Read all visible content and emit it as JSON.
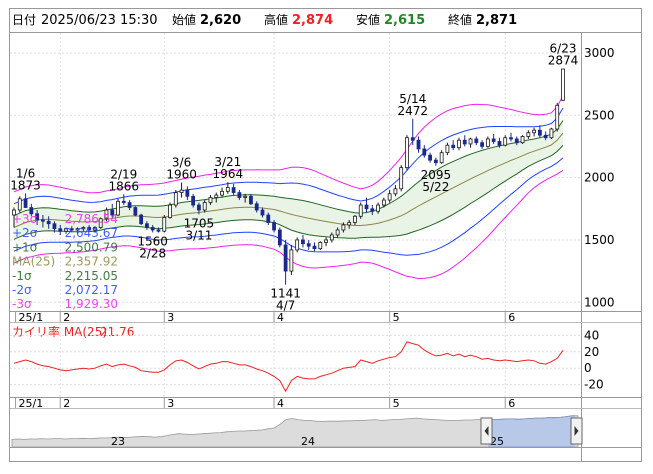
{
  "header": {
    "date_label": "日付",
    "datetime": "2025/06/23 15:30",
    "open_label": "始値",
    "open_value": "2,620",
    "high_label": "高値",
    "high_value": "2,874",
    "low_label": "安値",
    "low_value": "2,615",
    "close_label": "終値",
    "close_value": "2,871"
  },
  "colors": {
    "up": "#1a1a1a",
    "down": "#1a2a8a",
    "sigma3": "#ee22ee",
    "sigma2": "#2244ff",
    "sigma1": "#226622",
    "ma": "#888844",
    "deviation": "#ee2222",
    "high_value": "#ee2222",
    "low_value": "#228822",
    "volume_area": "#b8c8e8"
  },
  "chart_data": [
    {
      "type": "candlestick",
      "y_ticks": [
        "3000",
        "2500",
        "2000",
        "1500",
        "1000"
      ],
      "ylim": [
        930,
        3160
      ],
      "x_ticks": [
        "25/1",
        "2",
        "3",
        "4",
        "5",
        "6"
      ],
      "candles": [
        {
          "o": 1700,
          "h": 1760,
          "l": 1600,
          "c": 1740
        },
        {
          "o": 1740,
          "h": 1850,
          "l": 1720,
          "c": 1830
        },
        {
          "o": 1830,
          "h": 1873,
          "l": 1790,
          "c": 1760
        },
        {
          "o": 1760,
          "h": 1790,
          "l": 1690,
          "c": 1710
        },
        {
          "o": 1710,
          "h": 1740,
          "l": 1620,
          "c": 1660
        },
        {
          "o": 1660,
          "h": 1700,
          "l": 1600,
          "c": 1650
        },
        {
          "o": 1650,
          "h": 1690,
          "l": 1590,
          "c": 1630
        },
        {
          "o": 1630,
          "h": 1650,
          "l": 1560,
          "c": 1590
        },
        {
          "o": 1590,
          "h": 1620,
          "l": 1540,
          "c": 1570
        },
        {
          "o": 1570,
          "h": 1600,
          "l": 1550,
          "c": 1590
        },
        {
          "o": 1590,
          "h": 1610,
          "l": 1560,
          "c": 1580
        },
        {
          "o": 1580,
          "h": 1600,
          "l": 1550,
          "c": 1590
        },
        {
          "o": 1590,
          "h": 1610,
          "l": 1570,
          "c": 1600
        },
        {
          "o": 1600,
          "h": 1620,
          "l": 1570,
          "c": 1580
        },
        {
          "o": 1580,
          "h": 1610,
          "l": 1560,
          "c": 1600
        },
        {
          "o": 1600,
          "h": 1680,
          "l": 1590,
          "c": 1670
        },
        {
          "o": 1670,
          "h": 1760,
          "l": 1650,
          "c": 1740
        },
        {
          "o": 1740,
          "h": 1790,
          "l": 1680,
          "c": 1700
        },
        {
          "o": 1700,
          "h": 1830,
          "l": 1690,
          "c": 1810
        },
        {
          "o": 1810,
          "h": 1866,
          "l": 1780,
          "c": 1800
        },
        {
          "o": 1800,
          "h": 1820,
          "l": 1740,
          "c": 1760
        },
        {
          "o": 1760,
          "h": 1770,
          "l": 1690,
          "c": 1700
        },
        {
          "o": 1700,
          "h": 1710,
          "l": 1620,
          "c": 1630
        },
        {
          "o": 1630,
          "h": 1650,
          "l": 1580,
          "c": 1600
        },
        {
          "o": 1600,
          "h": 1620,
          "l": 1560,
          "c": 1580
        },
        {
          "o": 1580,
          "h": 1600,
          "l": 1560,
          "c": 1570
        },
        {
          "o": 1570,
          "h": 1700,
          "l": 1560,
          "c": 1680
        },
        {
          "o": 1680,
          "h": 1800,
          "l": 1670,
          "c": 1780
        },
        {
          "o": 1780,
          "h": 1900,
          "l": 1760,
          "c": 1880
        },
        {
          "o": 1880,
          "h": 1960,
          "l": 1840,
          "c": 1900
        },
        {
          "o": 1900,
          "h": 1930,
          "l": 1820,
          "c": 1850
        },
        {
          "o": 1850,
          "h": 1870,
          "l": 1760,
          "c": 1780
        },
        {
          "o": 1780,
          "h": 1800,
          "l": 1705,
          "c": 1740
        },
        {
          "o": 1740,
          "h": 1820,
          "l": 1720,
          "c": 1800
        },
        {
          "o": 1800,
          "h": 1860,
          "l": 1780,
          "c": 1840
        },
        {
          "o": 1840,
          "h": 1880,
          "l": 1800,
          "c": 1860
        },
        {
          "o": 1860,
          "h": 1920,
          "l": 1840,
          "c": 1890
        },
        {
          "o": 1890,
          "h": 1964,
          "l": 1870,
          "c": 1920
        },
        {
          "o": 1920,
          "h": 1950,
          "l": 1860,
          "c": 1880
        },
        {
          "o": 1880,
          "h": 1900,
          "l": 1820,
          "c": 1840
        },
        {
          "o": 1840,
          "h": 1870,
          "l": 1800,
          "c": 1850
        },
        {
          "o": 1850,
          "h": 1870,
          "l": 1780,
          "c": 1790
        },
        {
          "o": 1790,
          "h": 1810,
          "l": 1720,
          "c": 1740
        },
        {
          "o": 1740,
          "h": 1760,
          "l": 1680,
          "c": 1700
        },
        {
          "o": 1700,
          "h": 1720,
          "l": 1620,
          "c": 1640
        },
        {
          "o": 1640,
          "h": 1660,
          "l": 1560,
          "c": 1580
        },
        {
          "o": 1580,
          "h": 1600,
          "l": 1440,
          "c": 1460
        },
        {
          "o": 1460,
          "h": 1500,
          "l": 1141,
          "c": 1250
        },
        {
          "o": 1250,
          "h": 1460,
          "l": 1220,
          "c": 1420
        },
        {
          "o": 1420,
          "h": 1520,
          "l": 1400,
          "c": 1500
        },
        {
          "o": 1500,
          "h": 1540,
          "l": 1440,
          "c": 1470
        },
        {
          "o": 1470,
          "h": 1500,
          "l": 1420,
          "c": 1450
        },
        {
          "o": 1450,
          "h": 1480,
          "l": 1410,
          "c": 1430
        },
        {
          "o": 1430,
          "h": 1490,
          "l": 1420,
          "c": 1480
        },
        {
          "o": 1480,
          "h": 1520,
          "l": 1450,
          "c": 1500
        },
        {
          "o": 1500,
          "h": 1560,
          "l": 1480,
          "c": 1540
        },
        {
          "o": 1540,
          "h": 1600,
          "l": 1520,
          "c": 1580
        },
        {
          "o": 1580,
          "h": 1640,
          "l": 1560,
          "c": 1620
        },
        {
          "o": 1620,
          "h": 1660,
          "l": 1590,
          "c": 1640
        },
        {
          "o": 1640,
          "h": 1700,
          "l": 1620,
          "c": 1690
        },
        {
          "o": 1690,
          "h": 1800,
          "l": 1670,
          "c": 1780
        },
        {
          "o": 1780,
          "h": 1840,
          "l": 1720,
          "c": 1750
        },
        {
          "o": 1750,
          "h": 1780,
          "l": 1700,
          "c": 1730
        },
        {
          "o": 1730,
          "h": 1800,
          "l": 1710,
          "c": 1780
        },
        {
          "o": 1780,
          "h": 1840,
          "l": 1760,
          "c": 1820
        },
        {
          "o": 1820,
          "h": 1900,
          "l": 1800,
          "c": 1870
        },
        {
          "o": 1870,
          "h": 1940,
          "l": 1850,
          "c": 1910
        },
        {
          "o": 1910,
          "h": 2100,
          "l": 1890,
          "c": 2080
        },
        {
          "o": 2080,
          "h": 2340,
          "l": 2060,
          "c": 2320
        },
        {
          "o": 2320,
          "h": 2472,
          "l": 2260,
          "c": 2300
        },
        {
          "o": 2300,
          "h": 2330,
          "l": 2200,
          "c": 2230
        },
        {
          "o": 2230,
          "h": 2260,
          "l": 2160,
          "c": 2180
        },
        {
          "o": 2180,
          "h": 2200,
          "l": 2120,
          "c": 2140
        },
        {
          "o": 2140,
          "h": 2160,
          "l": 2095,
          "c": 2120
        },
        {
          "o": 2120,
          "h": 2220,
          "l": 2110,
          "c": 2200
        },
        {
          "o": 2200,
          "h": 2280,
          "l": 2180,
          "c": 2260
        },
        {
          "o": 2260,
          "h": 2300,
          "l": 2220,
          "c": 2240
        },
        {
          "o": 2240,
          "h": 2320,
          "l": 2220,
          "c": 2300
        },
        {
          "o": 2300,
          "h": 2340,
          "l": 2250,
          "c": 2270
        },
        {
          "o": 2270,
          "h": 2320,
          "l": 2240,
          "c": 2310
        },
        {
          "o": 2310,
          "h": 2330,
          "l": 2260,
          "c": 2280
        },
        {
          "o": 2280,
          "h": 2300,
          "l": 2230,
          "c": 2250
        },
        {
          "o": 2250,
          "h": 2330,
          "l": 2240,
          "c": 2310
        },
        {
          "o": 2310,
          "h": 2350,
          "l": 2270,
          "c": 2290
        },
        {
          "o": 2290,
          "h": 2320,
          "l": 2240,
          "c": 2260
        },
        {
          "o": 2260,
          "h": 2340,
          "l": 2250,
          "c": 2320
        },
        {
          "o": 2320,
          "h": 2360,
          "l": 2290,
          "c": 2310
        },
        {
          "o": 2310,
          "h": 2330,
          "l": 2260,
          "c": 2280
        },
        {
          "o": 2280,
          "h": 2340,
          "l": 2270,
          "c": 2330
        },
        {
          "o": 2330,
          "h": 2380,
          "l": 2310,
          "c": 2360
        },
        {
          "o": 2360,
          "h": 2400,
          "l": 2330,
          "c": 2380
        },
        {
          "o": 2380,
          "h": 2420,
          "l": 2320,
          "c": 2340
        },
        {
          "o": 2340,
          "h": 2370,
          "l": 2300,
          "c": 2320
        },
        {
          "o": 2320,
          "h": 2400,
          "l": 2310,
          "c": 2390
        },
        {
          "o": 2390,
          "h": 2600,
          "l": 2370,
          "c": 2580
        },
        {
          "o": 2620,
          "h": 2874,
          "l": 2615,
          "c": 2871
        }
      ],
      "ma25": [
        1600,
        1620,
        1640,
        1650,
        1660,
        1665,
        1665,
        1662,
        1658,
        1655,
        1650,
        1648,
        1645,
        1645,
        1648,
        1655,
        1665,
        1672,
        1680,
        1688,
        1692,
        1692,
        1690,
        1686,
        1682,
        1680,
        1684,
        1690,
        1698,
        1706,
        1712,
        1716,
        1720,
        1726,
        1732,
        1738,
        1745,
        1752,
        1757,
        1760,
        1762,
        1762,
        1760,
        1756,
        1750,
        1744,
        1732,
        1718,
        1705,
        1694,
        1684,
        1674,
        1665,
        1656,
        1648,
        1640,
        1632,
        1626,
        1620,
        1616,
        1616,
        1620,
        1626,
        1634,
        1646,
        1660,
        1676,
        1694,
        1718,
        1746,
        1772,
        1798,
        1822,
        1846,
        1870,
        1894,
        1918,
        1942,
        1966,
        1990,
        2012,
        2034,
        2056,
        2078,
        2098,
        2118,
        2138,
        2156,
        2176,
        2196,
        2212,
        2228,
        2244,
        2262,
        2300,
        2358
      ],
      "sigma1": [
        95,
        95,
        95,
        95,
        94,
        93,
        92,
        90,
        88,
        86,
        84,
        82,
        80,
        78,
        77,
        76,
        76,
        76,
        77,
        78,
        80,
        82,
        84,
        86,
        88,
        90,
        91,
        92,
        93,
        94,
        95,
        96,
        97,
        98,
        98,
        99,
        99,
        100,
        100,
        100,
        100,
        100,
        101,
        102,
        104,
        106,
        110,
        118,
        126,
        130,
        132,
        132,
        130,
        126,
        122,
        118,
        114,
        110,
        106,
        102,
        98,
        100,
        104,
        112,
        122,
        132,
        144,
        156,
        170,
        182,
        194,
        202,
        208,
        212,
        214,
        214,
        212,
        208,
        204,
        198,
        192,
        184,
        176,
        166,
        156,
        146,
        136,
        126,
        116,
        106,
        98,
        92,
        88,
        86,
        90,
        100
      ],
      "sigma_labels": [
        {
          "label": "+3σ",
          "value": "2,786.54",
          "color": "#ee22ee"
        },
        {
          "label": "+2σ",
          "value": "2,643.67",
          "color": "#2244ff"
        },
        {
          "label": "+1σ",
          "value": "2,500.79",
          "color": "#226622"
        },
        {
          "label": "MA(25)",
          "value": "2,357.92",
          "color": "#888844"
        },
        {
          "label": "-1σ",
          "value": "2,215.05",
          "color": "#226622"
        },
        {
          "label": "-2σ",
          "value": "2,072.17",
          "color": "#2244ff"
        },
        {
          "label": "-3σ",
          "value": "1,929.30",
          "color": "#ee22ee"
        }
      ],
      "annotations": [
        {
          "i": 2,
          "date": "1/6",
          "price": "1873",
          "pos": "above"
        },
        {
          "i": 19,
          "date": "2/19",
          "price": "1866",
          "pos": "above"
        },
        {
          "i": 24,
          "date": "2/28",
          "price": "1560",
          "pos": "below"
        },
        {
          "i": 29,
          "date": "3/6",
          "price": "1960",
          "pos": "above"
        },
        {
          "i": 32,
          "date": "3/11",
          "price": "1705",
          "pos": "below"
        },
        {
          "i": 37,
          "date": "3/21",
          "price": "1964",
          "pos": "above"
        },
        {
          "i": 47,
          "date": "4/7",
          "price": "1141",
          "pos": "below"
        },
        {
          "i": 69,
          "date": "5/14",
          "price": "2472",
          "pos": "above"
        },
        {
          "i": 73,
          "date": "5/22",
          "price": "2095",
          "pos": "below"
        },
        {
          "i": 95,
          "date": "6/23",
          "price": "2874",
          "pos": "above"
        }
      ]
    },
    {
      "type": "line",
      "title": "カイリ率 MA(25)",
      "current_value": "21.76",
      "y_ticks": [
        "40",
        "20",
        "0",
        "-20"
      ],
      "ylim": [
        -35,
        55
      ],
      "values": [
        6,
        8,
        10,
        8,
        5,
        3,
        2,
        0,
        -2,
        -3,
        -2,
        -1,
        0,
        -1,
        0,
        3,
        5,
        2,
        4,
        5,
        3,
        1,
        -3,
        -4,
        -5,
        -5,
        -2,
        4,
        9,
        10,
        7,
        3,
        -1,
        2,
        5,
        6,
        8,
        8,
        6,
        4,
        4,
        2,
        -1,
        -3,
        -6,
        -10,
        -15,
        -28,
        -15,
        -10,
        -12,
        -13,
        -13,
        -10,
        -8,
        -6,
        -3,
        0,
        1,
        2,
        10,
        8,
        6,
        9,
        11,
        13,
        14,
        20,
        32,
        30,
        28,
        22,
        18,
        15,
        16,
        18,
        15,
        17,
        14,
        16,
        14,
        11,
        12,
        10,
        9,
        10,
        9,
        8,
        9,
        10,
        9,
        6,
        5,
        8,
        12,
        21.76
      ]
    },
    {
      "type": "area",
      "x_ticks": [
        "25/1",
        "2",
        "3",
        "4",
        "5",
        "6"
      ],
      "period_labels": [
        "23",
        "24",
        "25"
      ],
      "values": [
        20,
        21,
        20,
        21,
        21,
        22,
        21,
        22,
        22,
        21,
        22,
        22,
        23,
        22,
        23,
        24,
        24,
        25,
        26,
        25,
        26,
        27,
        28,
        27,
        26,
        27,
        30,
        33,
        35,
        34,
        33,
        34,
        35,
        36,
        37,
        38,
        40,
        41,
        42,
        42,
        43,
        44,
        45,
        48,
        50,
        60,
        72,
        75,
        72,
        70,
        70,
        68,
        67,
        68,
        68,
        68,
        69,
        69,
        70,
        70,
        71,
        72,
        70,
        71,
        72,
        72,
        74,
        75,
        76,
        74,
        73,
        72,
        71,
        70,
        70,
        70,
        71,
        71,
        72,
        72,
        72,
        72,
        73,
        74,
        74,
        73,
        74,
        75,
        76,
        76,
        77,
        77,
        78,
        80,
        82,
        82
      ]
    }
  ]
}
